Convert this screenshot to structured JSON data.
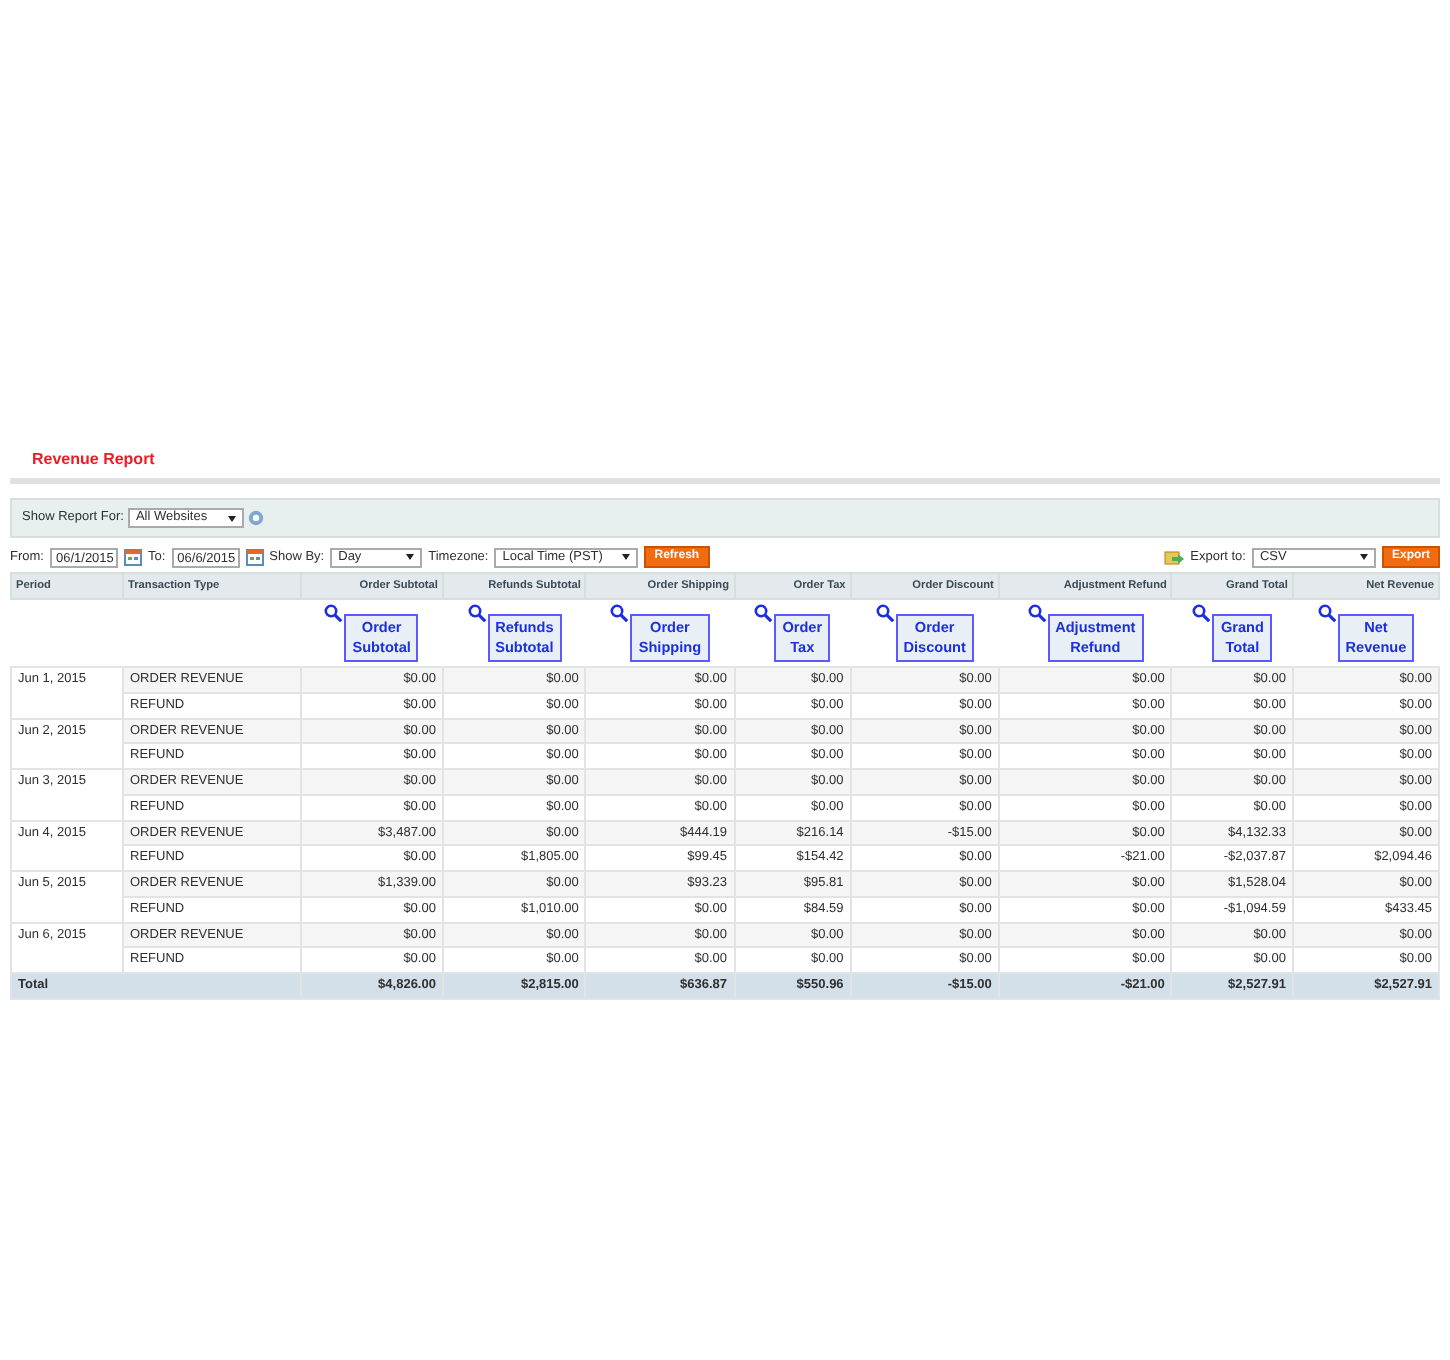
{
  "title": "Revenue Report",
  "filter": {
    "label": "Show Report For:",
    "value": "All Websites"
  },
  "controls": {
    "from_label": "From:",
    "from": "06/1/2015",
    "to_label": "To:",
    "to": "06/6/2015",
    "show_by_label": "Show By:",
    "show_by": "Day",
    "timezone_label": "Timezone:",
    "timezone": "Local Time (PST)",
    "refresh": "Refresh",
    "export_label": "Export to:",
    "export_format": "CSV",
    "export": "Export"
  },
  "table": {
    "columns": [
      "Period",
      "Transaction Type",
      "Order Subtotal",
      "Refunds Subtotal",
      "Order Shipping",
      "Order Tax",
      "Order Discount",
      "Adjustment Refund",
      "Grand Total",
      "Net Revenue"
    ],
    "callouts": [
      [
        "Order",
        "Subtotal"
      ],
      [
        "Refunds",
        "Subtotal"
      ],
      [
        "Order",
        "Shipping"
      ],
      [
        "Order",
        "Tax"
      ],
      [
        "Order",
        "Discount"
      ],
      [
        "Adjustment",
        "Refund"
      ],
      [
        "Grand",
        "Total"
      ],
      [
        "Net",
        "Revenue"
      ]
    ],
    "groups": [
      {
        "period": "Jun 1, 2015",
        "lines": [
          {
            "type": "ORDER REVENUE",
            "values": [
              "$0.00",
              "$0.00",
              "$0.00",
              "$0.00",
              "$0.00",
              "$0.00",
              "$0.00",
              "$0.00"
            ]
          },
          {
            "type": "REFUND",
            "values": [
              "$0.00",
              "$0.00",
              "$0.00",
              "$0.00",
              "$0.00",
              "$0.00",
              "$0.00",
              "$0.00"
            ]
          }
        ]
      },
      {
        "period": "Jun 2, 2015",
        "lines": [
          {
            "type": "ORDER REVENUE",
            "values": [
              "$0.00",
              "$0.00",
              "$0.00",
              "$0.00",
              "$0.00",
              "$0.00",
              "$0.00",
              "$0.00"
            ]
          },
          {
            "type": "REFUND",
            "values": [
              "$0.00",
              "$0.00",
              "$0.00",
              "$0.00",
              "$0.00",
              "$0.00",
              "$0.00",
              "$0.00"
            ]
          }
        ]
      },
      {
        "period": "Jun 3, 2015",
        "lines": [
          {
            "type": "ORDER REVENUE",
            "values": [
              "$0.00",
              "$0.00",
              "$0.00",
              "$0.00",
              "$0.00",
              "$0.00",
              "$0.00",
              "$0.00"
            ]
          },
          {
            "type": "REFUND",
            "values": [
              "$0.00",
              "$0.00",
              "$0.00",
              "$0.00",
              "$0.00",
              "$0.00",
              "$0.00",
              "$0.00"
            ]
          }
        ]
      },
      {
        "period": "Jun 4, 2015",
        "lines": [
          {
            "type": "ORDER REVENUE",
            "values": [
              "$3,487.00",
              "$0.00",
              "$444.19",
              "$216.14",
              "-$15.00",
              "$0.00",
              "$4,132.33",
              "$0.00"
            ]
          },
          {
            "type": "REFUND",
            "values": [
              "$0.00",
              "$1,805.00",
              "$99.45",
              "$154.42",
              "$0.00",
              "-$21.00",
              "-$2,037.87",
              "$2,094.46"
            ]
          }
        ]
      },
      {
        "period": "Jun 5, 2015",
        "lines": [
          {
            "type": "ORDER REVENUE",
            "values": [
              "$1,339.00",
              "$0.00",
              "$93.23",
              "$95.81",
              "$0.00",
              "$0.00",
              "$1,528.04",
              "$0.00"
            ]
          },
          {
            "type": "REFUND",
            "values": [
              "$0.00",
              "$1,010.00",
              "$0.00",
              "$84.59",
              "$0.00",
              "$0.00",
              "-$1,094.59",
              "$433.45"
            ]
          }
        ]
      },
      {
        "period": "Jun 6, 2015",
        "lines": [
          {
            "type": "ORDER REVENUE",
            "values": [
              "$0.00",
              "$0.00",
              "$0.00",
              "$0.00",
              "$0.00",
              "$0.00",
              "$0.00",
              "$0.00"
            ]
          },
          {
            "type": "REFUND",
            "values": [
              "$0.00",
              "$0.00",
              "$0.00",
              "$0.00",
              "$0.00",
              "$0.00",
              "$0.00",
              "$0.00"
            ]
          }
        ]
      }
    ],
    "total": {
      "label": "Total",
      "values": [
        "$4,826.00",
        "$2,815.00",
        "$636.87",
        "$550.96",
        "-$15.00",
        "-$21.00",
        "$2,527.91",
        "$2,527.91"
      ]
    }
  }
}
